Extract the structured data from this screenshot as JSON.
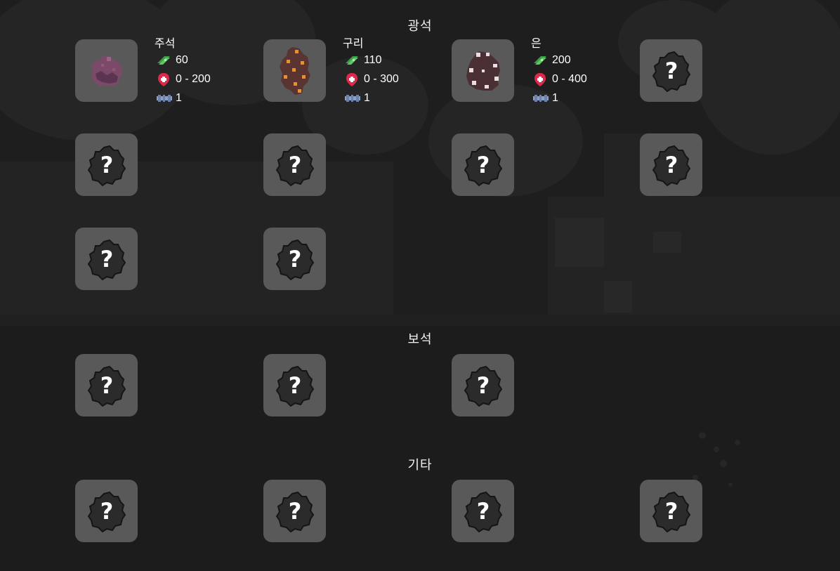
{
  "sections": {
    "ores": {
      "title": "광석"
    },
    "gems": {
      "title": "보석"
    },
    "misc": {
      "title": "기타"
    }
  },
  "ores": [
    {
      "name": "주석",
      "price": "60",
      "hp": "0 - 200",
      "tier": "1",
      "icon": "tin-ore-icon",
      "color": "#7a4a68"
    },
    {
      "name": "구리",
      "price": "110",
      "hp": "0 - 300",
      "tier": "1",
      "icon": "copper-ore-icon",
      "color": "#5a3430"
    },
    {
      "name": "은",
      "price": "200",
      "hp": "0 - 400",
      "tier": "1",
      "icon": "silver-ore-icon",
      "color": "#4a3034"
    }
  ],
  "locked_label": "?",
  "stat_icons": {
    "price": "cash-icon",
    "hp": "health-icon",
    "tier": "pickaxe-icon"
  },
  "colors": {
    "slot_bg": "#595959",
    "locked_rock": "#2b2b2b",
    "cash": "#5bc860",
    "health": "#e0284a",
    "pickaxe": "#8aa0c8"
  }
}
